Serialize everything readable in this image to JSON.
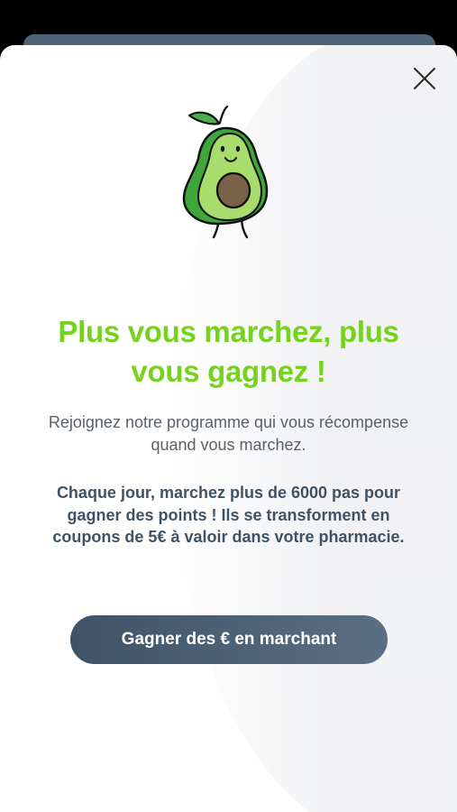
{
  "title": "Plus vous marchez, plus vous gagnez !",
  "subtitle": "Rejoignez notre programme qui vous récompense quand vous marchez.",
  "body": "Chaque jour, marchez plus de 6000 pas pour gagner des points ! Ils se transforment en coupons de 5€ à valoir dans votre pharmacie.",
  "cta_label": "Gagner des € en marchant",
  "icons": {
    "close": "close-icon",
    "mascot": "avocado-mascot-icon"
  },
  "colors": {
    "title": "#76d31d",
    "cta_bg": "#3e5366",
    "body_text": "#3e5366",
    "subtitle_text": "#5a6168"
  }
}
